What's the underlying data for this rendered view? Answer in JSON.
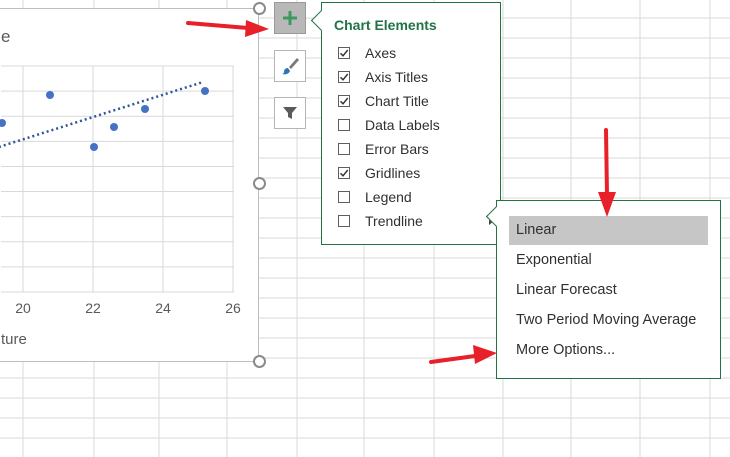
{
  "chart": {
    "title_fragment": "e",
    "x_axis_title_fragment": "ture",
    "x_ticks": [
      "20",
      "22",
      "24",
      "26"
    ],
    "marker_color": "#4472C4",
    "trendline_color": "#2F5597"
  },
  "chart_elements_panel": {
    "title": "Chart Elements",
    "title_color": "#217346",
    "items": [
      {
        "label": "Axes",
        "checked": true
      },
      {
        "label": "Axis Titles",
        "checked": true
      },
      {
        "label": "Chart Title",
        "checked": true
      },
      {
        "label": "Data Labels",
        "checked": false
      },
      {
        "label": "Error Bars",
        "checked": false
      },
      {
        "label": "Gridlines",
        "checked": true
      },
      {
        "label": "Legend",
        "checked": false
      },
      {
        "label": "Trendline",
        "checked": false,
        "has_submenu": true
      }
    ]
  },
  "trendline_submenu": {
    "items": [
      {
        "label": "Linear",
        "selected": true
      },
      {
        "label": "Exponential",
        "selected": false
      },
      {
        "label": "Linear Forecast",
        "selected": false
      },
      {
        "label": "Two Period Moving Average",
        "selected": false
      },
      {
        "label": "More Options...",
        "selected": false
      }
    ]
  },
  "side_buttons": [
    {
      "name": "chart-elements-button",
      "icon": "plus-icon",
      "active": true
    },
    {
      "name": "chart-styles-button",
      "icon": "paintbrush-icon",
      "active": false
    },
    {
      "name": "chart-filters-button",
      "icon": "funnel-icon",
      "active": false
    }
  ],
  "annotation_color": "#E8202A"
}
